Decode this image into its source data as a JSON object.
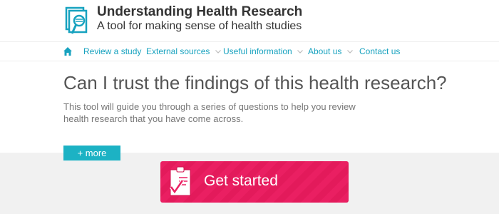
{
  "header": {
    "title": "Understanding Health Research",
    "tagline": "A tool for making sense of health studies",
    "logo_icon": "document-magnifier-icon",
    "accent": "#17a2bf"
  },
  "nav": {
    "home_icon": "home-icon",
    "items": [
      {
        "label": "Review a study",
        "dropdown": false
      },
      {
        "label": "External sources",
        "dropdown": true
      },
      {
        "label": "Useful information",
        "dropdown": true
      },
      {
        "label": "About us",
        "dropdown": true
      },
      {
        "label": "Contact us",
        "dropdown": false
      }
    ]
  },
  "main": {
    "headline": "Can I trust the findings of this health research?",
    "intro": "This tool will guide you through a series of questions to help you review health research that you have come across.",
    "more_label": "+ more",
    "more_color": "#1cb2c4"
  },
  "cta": {
    "label": "Get started",
    "icon": "clipboard-check-icon",
    "color": "#ea1f62"
  }
}
